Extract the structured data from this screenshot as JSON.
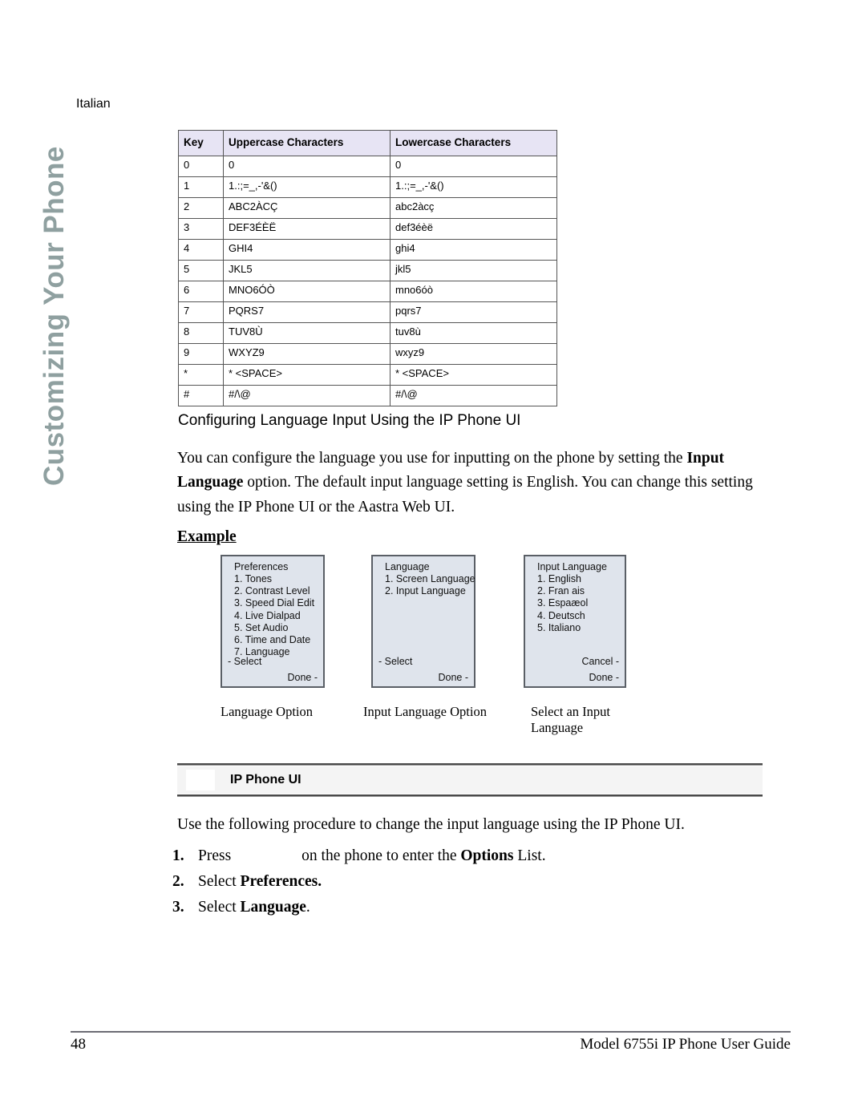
{
  "chapter_tab": {
    "label": "Customizing Your Phone",
    "color": "#8fa0a0"
  },
  "language_label": "Italian",
  "char_table": {
    "headers": [
      "Key",
      "Uppercase Characters",
      "Lowercase Characters"
    ],
    "header_bg": "#e7e4f4",
    "rows": [
      {
        "key": "0",
        "upper": "0",
        "lower": "0"
      },
      {
        "key": "1",
        "upper": "1.:;=_,-'&()",
        "lower": "1.:;=_,-'&()"
      },
      {
        "key": "2",
        "upper": "ABC2ÀCÇ",
        "lower": "abc2àcç"
      },
      {
        "key": "3",
        "upper": "DEF3ÉÈË",
        "lower": "def3éèë"
      },
      {
        "key": "4",
        "upper": "GHI4",
        "lower": "ghi4"
      },
      {
        "key": "5",
        "upper": "JKL5",
        "lower": "jkl5"
      },
      {
        "key": "6",
        "upper": "MNO6ÓÒ",
        "lower": "mno6óò"
      },
      {
        "key": "7",
        "upper": "PQRS7",
        "lower": "pqrs7"
      },
      {
        "key": "8",
        "upper": "TUV8Ù",
        "lower": "tuv8ù"
      },
      {
        "key": "9",
        "upper": "WXYZ9",
        "lower": "wxyz9"
      },
      {
        "key": "*",
        "upper": "* <SPACE>",
        "lower": "* <SPACE>"
      },
      {
        "key": "#",
        "upper": "#/\\@",
        "lower": "#/\\@"
      }
    ]
  },
  "section": {
    "heading": "Configuring Language Input Using the IP Phone UI",
    "paragraph_part1": "You can configure the language you use for inputting on the phone by setting the ",
    "paragraph_bold1": "Input Language",
    "paragraph_part2": " option. The default input language setting is English. You can change this setting using the IP Phone UI or the Aastra Web UI.",
    "example_label": "Example"
  },
  "screens": [
    {
      "title": "Preferences",
      "items": [
        "1. Tones",
        "2. Contrast Level",
        "3. Speed Dial Edit",
        "4. Live Dialpad",
        "5. Set Audio",
        "6. Time and Date",
        "7. Language"
      ],
      "softkey_left": "- Select",
      "softkey_right": "Done -",
      "caption": "Language Option"
    },
    {
      "title": "Language",
      "items": [
        "1. Screen Language",
        "2. Input Language"
      ],
      "softkey_left": "- Select",
      "softkey_right": "Done -",
      "caption": "Input Language Option"
    },
    {
      "title": "Input Language",
      "items": [
        "1. English",
        "2. Fran ais",
        "3. Espaæol",
        "4. Deutsch",
        "5. Italiano"
      ],
      "softkey_left": "",
      "softkey_right": "Done -",
      "softkey_right2": "Cancel -",
      "caption": "Select an Input Language"
    }
  ],
  "ip_phone_band": {
    "title": "IP Phone UI",
    "bg": "#f4f4f4"
  },
  "procedure": {
    "intro": "Use the following procedure to change the input language using the IP Phone UI.",
    "steps": [
      {
        "num": "1.",
        "pre": "Press",
        "mid": "on the phone to enter the ",
        "bold": "Options",
        "post": " List."
      },
      {
        "num": "2.",
        "pre": "Select ",
        "bold": "Preferences.",
        "post": ""
      },
      {
        "num": "3.",
        "pre": "Select ",
        "bold": "Language",
        "post": "."
      }
    ]
  },
  "footer": {
    "page_number": "48",
    "guide_title": "Model 6755i IP Phone User Guide"
  }
}
